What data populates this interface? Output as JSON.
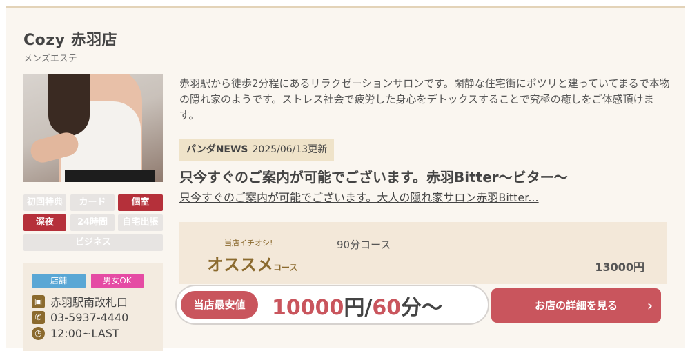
{
  "shop": {
    "name": "Cozy 赤羽店",
    "category": "メンズエステ",
    "description": "赤羽駅から徒歩2分程にあるリラクゼーションサロンです。閑静な住宅街にポツリと建っていてまるで本物の隠れ家のようです。ストレス社会で疲労した身心をデトックスすることで究極の癒しをご体感頂けます。"
  },
  "tags": [
    {
      "label": "初回特典",
      "active": false
    },
    {
      "label": "カード",
      "active": false
    },
    {
      "label": "個室",
      "active": true
    },
    {
      "label": "深夜",
      "active": true
    },
    {
      "label": "24時間",
      "active": false
    },
    {
      "label": "自宅出張",
      "active": false
    },
    {
      "label": "ビジネス",
      "active": false
    }
  ],
  "info": {
    "badges": [
      "店舗",
      "男女OK"
    ],
    "station": "赤羽駅南改札口",
    "phone": "03-5937-4440",
    "hours": "12:00~LAST",
    "icons": [
      "train-icon",
      "phone-icon",
      "clock-icon"
    ]
  },
  "news": {
    "label": "パンダNEWS",
    "updated": "2025/06/13更新",
    "title": "只今すぐのご案内が可能でございます。赤羽Bitter〜ビター〜",
    "excerpt": "只今すぐのご案内が可能でございます。大人の隠れ家サロン赤羽Bitter..."
  },
  "recommend": {
    "small": "当店イチオシ!",
    "big": "オススメ",
    "big_suffix": "コース",
    "course": "90分コース",
    "price": "13000円"
  },
  "lowest_price": {
    "label": "当店最安値",
    "amount": "10000",
    "yen": "円/",
    "minutes": "60",
    "suffix": "分〜"
  },
  "detail_button": {
    "label": "お店の詳細を見る",
    "chevron": "›"
  },
  "colors": {
    "accent": "#c9555d",
    "tag_active": "#b5303a",
    "tag_inactive": "#e7e4e2",
    "gold": "#8b6a2e",
    "store_badge": "#5aa7d5",
    "mixed_badge": "#e54ba4"
  }
}
